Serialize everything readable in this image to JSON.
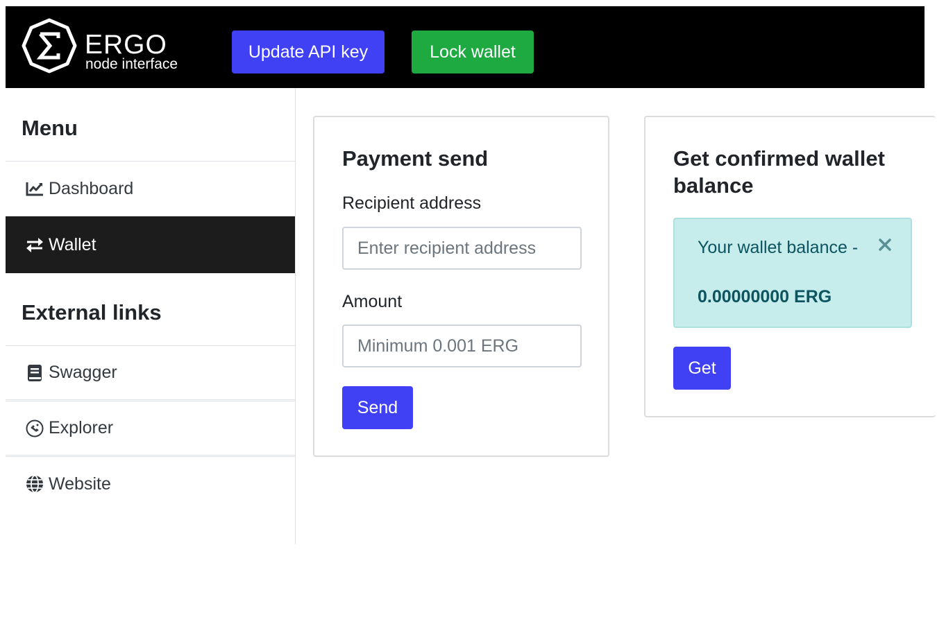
{
  "header": {
    "logo_title": "ERGO",
    "logo_subtitle": "node interface",
    "update_api_key_label": "Update API key",
    "lock_wallet_label": "Lock wallet"
  },
  "sidebar": {
    "menu_heading": "Menu",
    "menu_items": [
      {
        "label": "Dashboard",
        "icon": "chart-line-icon"
      },
      {
        "label": "Wallet",
        "icon": "exchange-arrows-icon",
        "active": true
      }
    ],
    "external_heading": "External links",
    "external_items": [
      {
        "label": "Swagger",
        "icon": "book-icon"
      },
      {
        "label": "Explorer",
        "icon": "satellite-icon"
      },
      {
        "label": "Website",
        "icon": "globe-icon"
      }
    ]
  },
  "payment": {
    "title": "Payment send",
    "recipient_label": "Recipient address",
    "recipient_placeholder": "Enter recipient address",
    "amount_label": "Amount",
    "amount_placeholder": "Minimum 0.001 ERG",
    "send_label": "Send"
  },
  "balance": {
    "title": "Get confirmed wallet balance",
    "alert_text": "Your wallet balance -",
    "alert_amount": "0.00000000 ERG",
    "get_label": "Get"
  },
  "colors": {
    "primary": "#4040f5",
    "success": "#1eaa41",
    "header_bg": "#000000",
    "active_item_bg": "#1c1c1c",
    "alert_bg": "#c6ecec",
    "alert_text": "#0c5460"
  }
}
